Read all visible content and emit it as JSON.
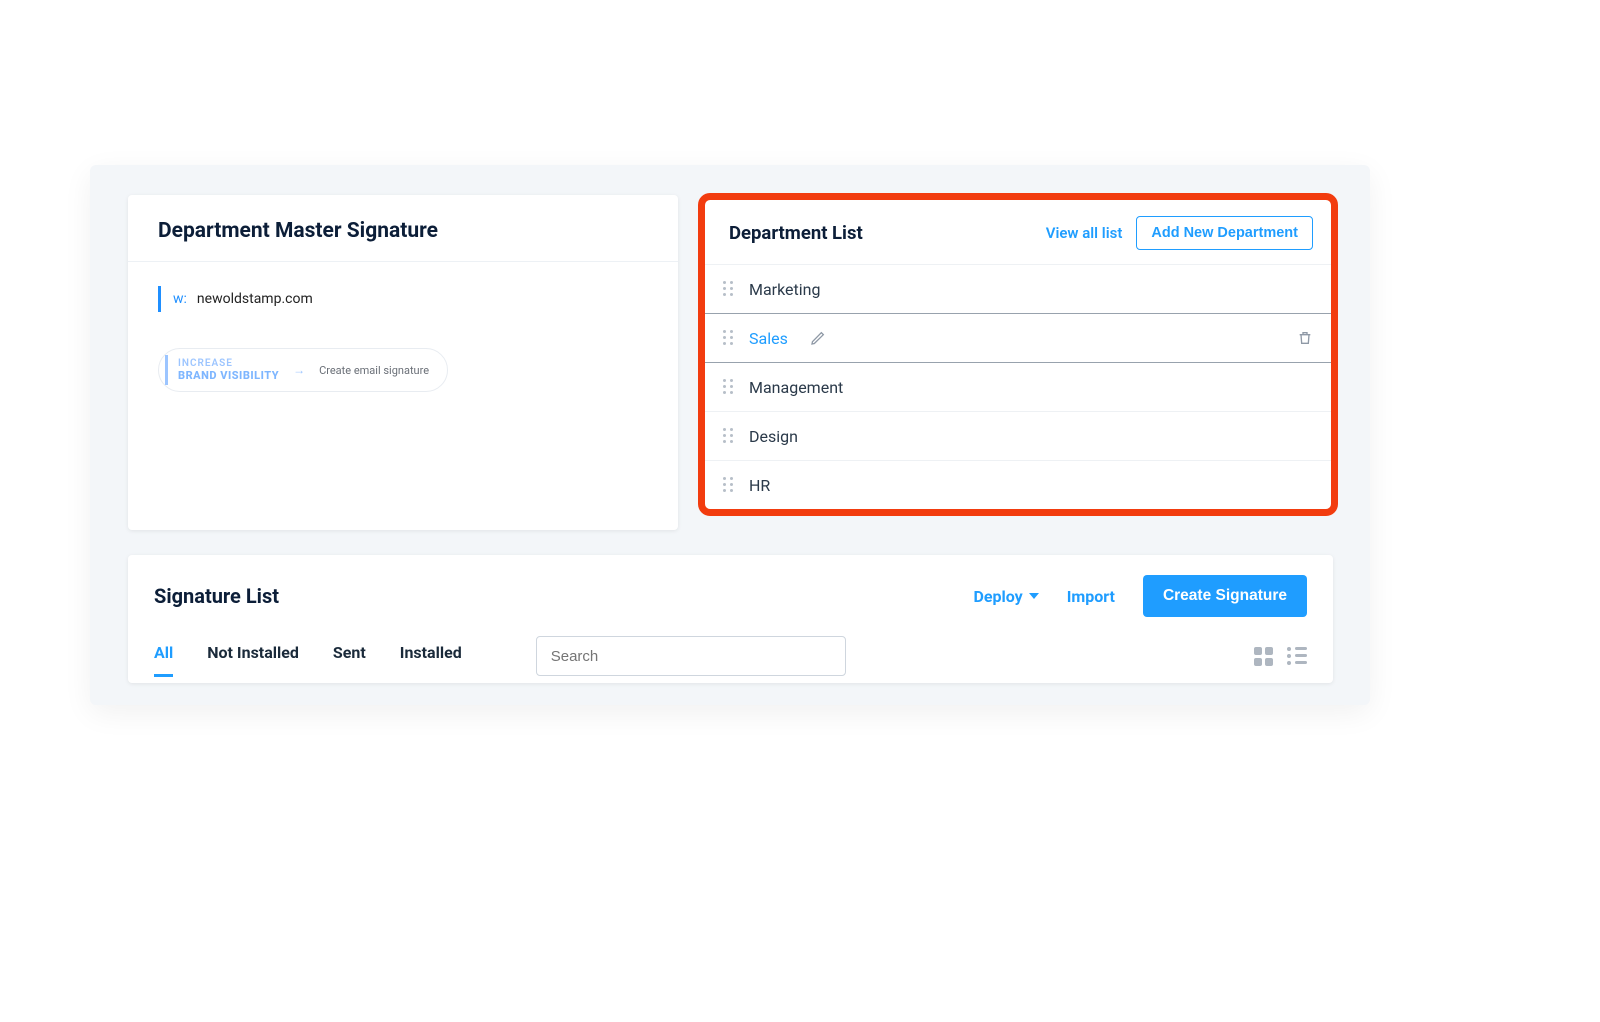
{
  "master": {
    "title": "Department Master Signature",
    "w_prefix": "w:",
    "website": "newoldstamp.com",
    "banner_line1": "INCREASE",
    "banner_line2": "BRAND VISIBILITY",
    "banner_cta": "Create email signature"
  },
  "dept": {
    "title": "Department List",
    "view_all": "View all list",
    "add_new": "Add New Department",
    "items": [
      {
        "name": "Marketing",
        "active": false
      },
      {
        "name": "Sales",
        "active": true
      },
      {
        "name": "Management",
        "active": false
      },
      {
        "name": "Design",
        "active": false
      },
      {
        "name": "HR",
        "active": false
      }
    ]
  },
  "siglist": {
    "title": "Signature List",
    "deploy": "Deploy",
    "import": "Import",
    "create": "Create Signature",
    "tabs": {
      "all": "All",
      "not_installed": "Not Installed",
      "sent": "Sent",
      "installed": "Installed"
    },
    "search_placeholder": "Search"
  }
}
